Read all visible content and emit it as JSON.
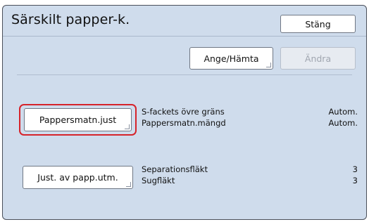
{
  "header": {
    "title": "Särskilt papper-k.",
    "close_label": "Stäng"
  },
  "toolbar": {
    "set_get_label": "Ange/Hämta",
    "change_label": "Ändra"
  },
  "sections": [
    {
      "button_label": "Pappersmatn.just",
      "selected": true,
      "rows": [
        {
          "label": "S-fackets övre gräns",
          "value": "Autom."
        },
        {
          "label": "Pappersmatn.mängd",
          "value": "Autom."
        }
      ]
    },
    {
      "button_label": "Just. av papp.utm.",
      "selected": false,
      "rows": [
        {
          "label": "Separationsfläkt",
          "value": "3"
        },
        {
          "label": "Sugfläkt",
          "value": "3"
        }
      ]
    }
  ],
  "colors": {
    "panel_background": "#cfdcec",
    "selection_outline": "#d6232a"
  }
}
